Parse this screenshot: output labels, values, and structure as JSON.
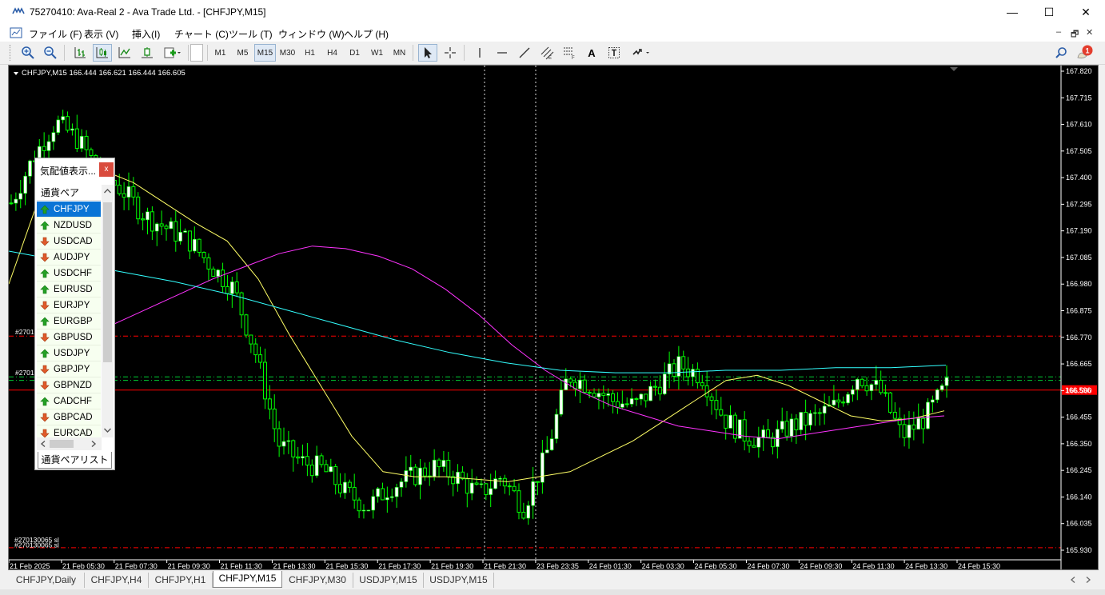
{
  "window": {
    "title": "75270410: Ava-Real 2 - Ava Trade Ltd. - [CHFJPY,M15]",
    "controls": [
      "—",
      "☐",
      "✕"
    ]
  },
  "menu": {
    "items": [
      "ファイル (F)",
      "表示 (V)",
      "挿入(I)",
      "チャート (C)",
      "ツール (T)",
      "ウィンドウ (W)",
      "ヘルプ (H)"
    ],
    "mdi": [
      "–",
      "🗗",
      "✕"
    ]
  },
  "toolbar": {
    "timeframes": [
      "M1",
      "M5",
      "M15",
      "M30",
      "H1",
      "H4",
      "D1",
      "W1",
      "MN"
    ],
    "active_timeframe": "M15",
    "draw_text_tool": "A",
    "notification_count": "1"
  },
  "chart": {
    "header": "CHFJPY,M15  166.444 166.621 166.444 166.605",
    "current_price_label": "166.596",
    "trade_labels": [
      "#2701",
      "#2701",
      "#270130065 sl",
      "#270130065 sl"
    ],
    "colors": {
      "background": "#000000",
      "bull_candle": "#ffffff",
      "candle_wick": "#00ff00",
      "ma_fast": "#ffff66",
      "ma_mid": "#ff33ff",
      "ma_slow": "#33ffff",
      "level_red": "#ff0000",
      "level_green": "#00cc33"
    }
  },
  "chart_data": {
    "type": "line",
    "title": "CHFJPY,M15",
    "y_ticks": [
      "167.820",
      "167.715",
      "167.610",
      "167.505",
      "167.400",
      "167.295",
      "167.190",
      "167.085",
      "166.980",
      "166.875",
      "166.770",
      "166.665",
      "166.560",
      "166.455",
      "166.350",
      "166.245",
      "166.140",
      "166.035",
      "165.930"
    ],
    "x_ticks": [
      "21 Feb 2025",
      "21 Feb 05:30",
      "21 Feb 07:30",
      "21 Feb 09:30",
      "21 Feb 11:30",
      "21 Feb 13:30",
      "21 Feb 15:30",
      "21 Feb 17:30",
      "21 Feb 19:30",
      "21 Feb 21:30",
      "23 Feb 23:35",
      "24 Feb 01:30",
      "24 Feb 03:30",
      "24 Feb 05:30",
      "24 Feb 07:30",
      "24 Feb 09:30",
      "24 Feb 11:30",
      "24 Feb 13:30",
      "24 Feb 15:30"
    ],
    "ylim": [
      165.93,
      167.82
    ],
    "price_path": [
      167.3,
      167.48,
      167.62,
      167.55,
      167.42,
      167.35,
      167.25,
      167.2,
      167.15,
      167.05,
      166.96,
      166.7,
      166.35,
      166.28,
      166.25,
      166.16,
      166.1,
      166.18,
      166.22,
      166.26,
      166.22,
      166.15,
      166.22,
      166.1,
      166.3,
      166.62,
      166.58,
      166.52,
      166.5,
      166.58,
      166.66,
      166.62,
      166.45,
      166.38,
      166.36,
      166.42,
      166.45,
      166.5,
      166.62,
      166.56,
      166.38,
      166.45,
      166.58
    ],
    "series": [
      {
        "name": "ma_fast",
        "values": [
          166.98,
          167.33,
          167.44,
          167.43,
          167.38,
          167.3,
          167.22,
          167.15,
          167.0,
          166.78,
          166.58,
          166.38,
          166.24,
          166.22,
          166.22,
          166.21,
          166.2,
          166.22,
          166.24,
          166.3,
          166.36,
          166.44,
          166.52,
          166.6,
          166.62,
          166.58,
          166.52,
          166.46,
          166.44,
          166.45,
          166.48
        ]
      },
      {
        "name": "ma_mid",
        "values": [
          166.82,
          166.88,
          166.94,
          167.0,
          167.05,
          167.1,
          167.13,
          167.12,
          167.09,
          167.04,
          166.96,
          166.86,
          166.74,
          166.64,
          166.56,
          166.5,
          166.46,
          166.42,
          166.4,
          166.38,
          166.37,
          166.39,
          166.41,
          166.43,
          166.45,
          166.46
        ]
      },
      {
        "name": "ma_slow",
        "values": [
          167.11,
          167.07,
          167.03,
          166.99,
          166.94,
          166.88,
          166.82,
          166.76,
          166.71,
          166.67,
          166.64,
          166.63,
          166.63,
          166.64,
          166.64,
          166.65,
          166.65,
          166.66
        ]
      }
    ],
    "levels": [
      166.775,
      166.614,
      166.6,
      166.562,
      165.94
    ],
    "grid": false
  },
  "market_watch": {
    "title": "気配値表示...",
    "close": "x",
    "column_header": "通貨ペア",
    "tab": "通貨ペアリスト",
    "symbols": [
      {
        "name": "CHFJPY",
        "dir": "up"
      },
      {
        "name": "NZDUSD",
        "dir": "up"
      },
      {
        "name": "USDCAD",
        "dir": "down"
      },
      {
        "name": "AUDJPY",
        "dir": "down"
      },
      {
        "name": "USDCHF",
        "dir": "up"
      },
      {
        "name": "EURUSD",
        "dir": "up"
      },
      {
        "name": "EURJPY",
        "dir": "down"
      },
      {
        "name": "EURGBP",
        "dir": "up"
      },
      {
        "name": "GBPUSD",
        "dir": "down"
      },
      {
        "name": "USDJPY",
        "dir": "up"
      },
      {
        "name": "GBPJPY",
        "dir": "down"
      },
      {
        "name": "GBPNZD",
        "dir": "down"
      },
      {
        "name": "CADCHF",
        "dir": "up"
      },
      {
        "name": "GBPCAD",
        "dir": "down"
      },
      {
        "name": "EURCAD",
        "dir": "down"
      }
    ]
  },
  "tabs": {
    "items": [
      "CHFJPY,Daily",
      "CHFJPY,H4",
      "CHFJPY,H1",
      "CHFJPY,M15",
      "CHFJPY,M30",
      "USDJPY,M15",
      "USDJPY,M15"
    ],
    "active": "CHFJPY,M15"
  }
}
